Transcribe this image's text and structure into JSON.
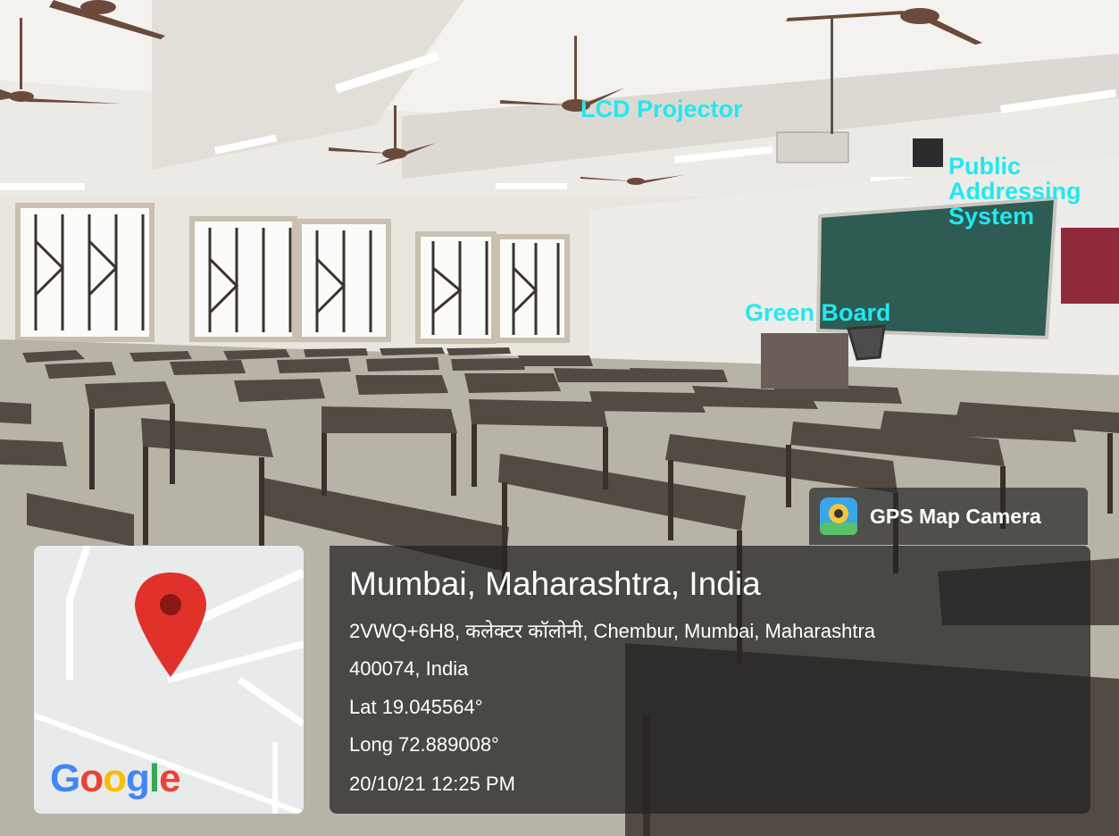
{
  "annotations": {
    "lcd_projector": "LCD Projector",
    "public_addressing": "Public\nAddressing\nSystem",
    "green_board": "Green Board"
  },
  "badge": {
    "app_name": "GPS Map Camera",
    "icon": "camera-pin-icon"
  },
  "map": {
    "logo_text": "Google",
    "pin_icon": "location-pin-icon"
  },
  "info": {
    "location_title": "Mumbai, Maharashtra, India",
    "address_line1": "2VWQ+6H8, कलेक्टर कॉलोनी, Chembur, Mumbai, Maharashtra",
    "address_line2": "400074, India",
    "latitude": "Lat 19.045564°",
    "longitude": "Long 72.889008°",
    "datetime": "20/10/21 12:25 PM"
  },
  "colors": {
    "annotation": "#22e8f0",
    "board": "#2e5b52",
    "pin": "#e0322a"
  }
}
